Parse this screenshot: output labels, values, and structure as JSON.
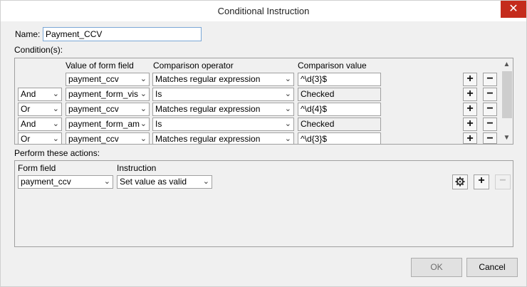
{
  "window": {
    "title": "Conditional Instruction",
    "close_glyph": "✕"
  },
  "name": {
    "label": "Name:",
    "value": "Payment_CCV"
  },
  "conditions": {
    "label": "Condition(s):",
    "headers": {
      "field": "Value of form field",
      "operator": "Comparison operator",
      "value": "Comparison value"
    },
    "rows": [
      {
        "join": "",
        "field": "payment_ccv",
        "operator": "Matches regular expression",
        "value": "^\\d{3}$",
        "value_editable": true
      },
      {
        "join": "And",
        "field": "payment_form_vis",
        "operator": "Is",
        "value": "Checked",
        "value_editable": false
      },
      {
        "join": "Or",
        "field": "payment_ccv",
        "operator": "Matches regular expression",
        "value": "^\\d{4}$",
        "value_editable": true
      },
      {
        "join": "And",
        "field": "payment_form_am",
        "operator": "Is",
        "value": "Checked",
        "value_editable": false
      },
      {
        "join": "Or",
        "field": "payment_ccv",
        "operator": "Matches regular expression",
        "value": "^\\d{3}$",
        "value_editable": true
      }
    ],
    "add_glyph": "+",
    "remove_glyph": "−"
  },
  "actions": {
    "label": "Perform these actions:",
    "headers": {
      "field": "Form field",
      "instruction": "Instruction"
    },
    "rows": [
      {
        "field": "payment_ccv",
        "instruction": "Set value as valid"
      }
    ],
    "settings_icon": "gear-icon",
    "add_glyph": "+",
    "remove_glyph": "−"
  },
  "buttons": {
    "ok": "OK",
    "cancel": "Cancel"
  },
  "chevron": "⌄"
}
